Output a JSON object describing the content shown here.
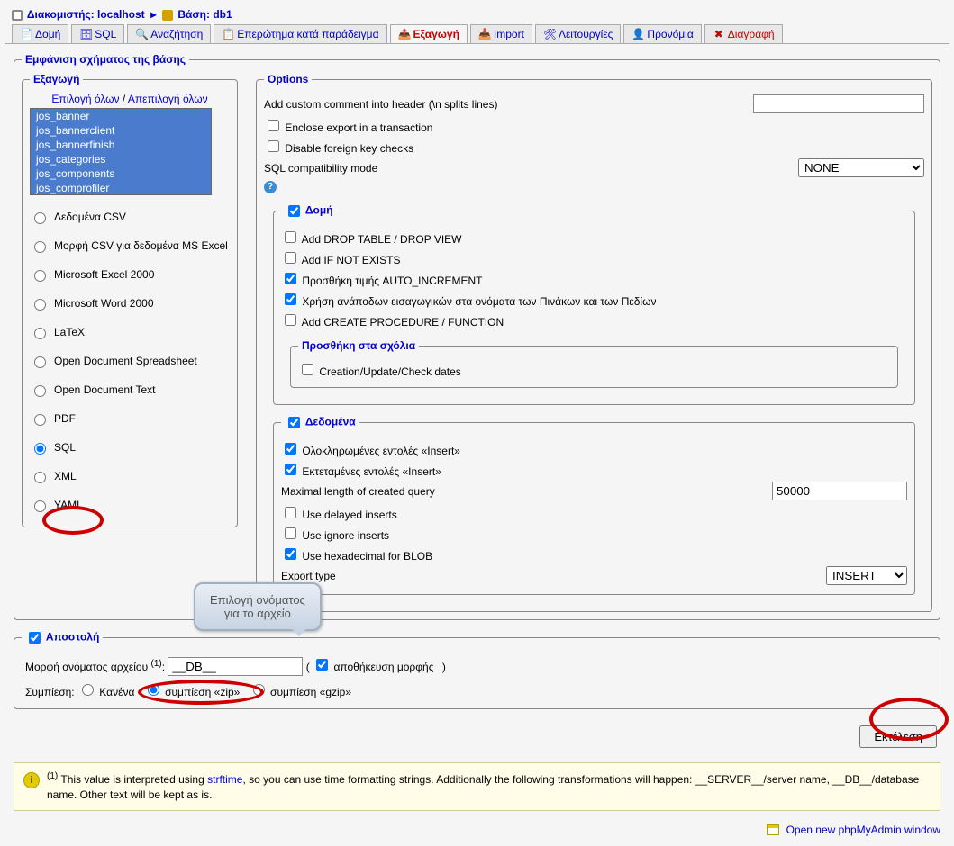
{
  "breadcrumb": {
    "server_label": "Διακομιστής:",
    "server_name": "localhost",
    "db_label": "Βάση:",
    "db_name": "db1"
  },
  "tabs": [
    {
      "label": "Δομή",
      "active": false
    },
    {
      "label": "SQL",
      "active": false
    },
    {
      "label": "Αναζήτηση",
      "active": false
    },
    {
      "label": "Επερώτημα κατά παράδειγμα",
      "active": false
    },
    {
      "label": "Εξαγωγή",
      "active": true
    },
    {
      "label": "Import",
      "active": false
    },
    {
      "label": "Λειτουργίες",
      "active": false
    },
    {
      "label": "Προνόμια",
      "active": false
    },
    {
      "label": "Διαγραφή",
      "active": false
    }
  ],
  "view_schema_legend": "Εμφάνιση σχήματος της βάσης",
  "export_panel": {
    "legend": "Εξαγωγή",
    "select_all": "Επιλογή όλων",
    "unselect_all": "Απεπιλογή όλων",
    "tables": [
      "jos_banner",
      "jos_bannerclient",
      "jos_bannerfinish",
      "jos_categories",
      "jos_components",
      "jos_comprofiler"
    ],
    "formats": [
      "Δεδομένα CSV",
      "Μορφή CSV για δεδομένα MS Excel",
      "Microsoft Excel 2000",
      "Microsoft Word 2000",
      "LaTeX",
      "Open Document Spreadsheet",
      "Open Document Text",
      "PDF",
      "SQL",
      "XML",
      "YAML"
    ],
    "selected_format": "SQL"
  },
  "options_panel": {
    "legend": "Options",
    "custom_comment": "Add custom comment into header (\\n splits lines)",
    "enclose_transaction": "Enclose export in a transaction",
    "disable_fk": "Disable foreign key checks",
    "sql_compat_label": "SQL compatibility mode",
    "sql_compat_value": "NONE",
    "structure": {
      "legend": "Δομή",
      "add_drop": "Add DROP TABLE / DROP VIEW",
      "add_ifnotexists": "Add IF NOT EXISTS",
      "auto_increment": "Προσθήκη τιμής AUTO_INCREMENT",
      "backquotes": "Χρήση ανάποδων εισαγωγικών στα ονόματα των Πινάκων και των Πεδίων",
      "add_procedure": "Add CREATE PROCEDURE / FUNCTION",
      "comments": {
        "legend": "Προσθήκη στα σχόλια",
        "dates": "Creation/Update/Check dates"
      }
    },
    "data": {
      "legend": "Δεδομένα",
      "complete_inserts": "Ολοκληρωμένες εντολές «Insert»",
      "extended_inserts": "Εκτεταμένες εντολές «Insert»",
      "max_query_label": "Maximal length of created query",
      "max_query_value": "50000",
      "delayed": "Use delayed inserts",
      "ignore": "Use ignore inserts",
      "hex_blob": "Use hexadecimal for BLOB",
      "export_type_label": "Export type",
      "export_type_value": "INSERT"
    }
  },
  "callout": {
    "line1": "Επιλογή ονόματος",
    "line2": "για το αρχείο"
  },
  "send": {
    "legend": "Αποστολή",
    "filename_label": "Μορφή ονόματος αρχείου",
    "filename_value": "__DB__",
    "remember": "αποθήκευση μορφής",
    "compression_label": "Συμπίεση:",
    "none": "Κανένα",
    "zip": "συμπίεση «zip»",
    "gzip": "συμπίεση «gzip»"
  },
  "execute_button": "Εκτέλεση",
  "footnote": {
    "prefix": "This value is interpreted using",
    "strftime": "strftime",
    "rest": ", so you can use time formatting strings. Additionally the following transformations will happen: __SERVER__/server name, __DB__/database name. Other text will be kept as is."
  },
  "open_new": "Open new phpMyAdmin window"
}
